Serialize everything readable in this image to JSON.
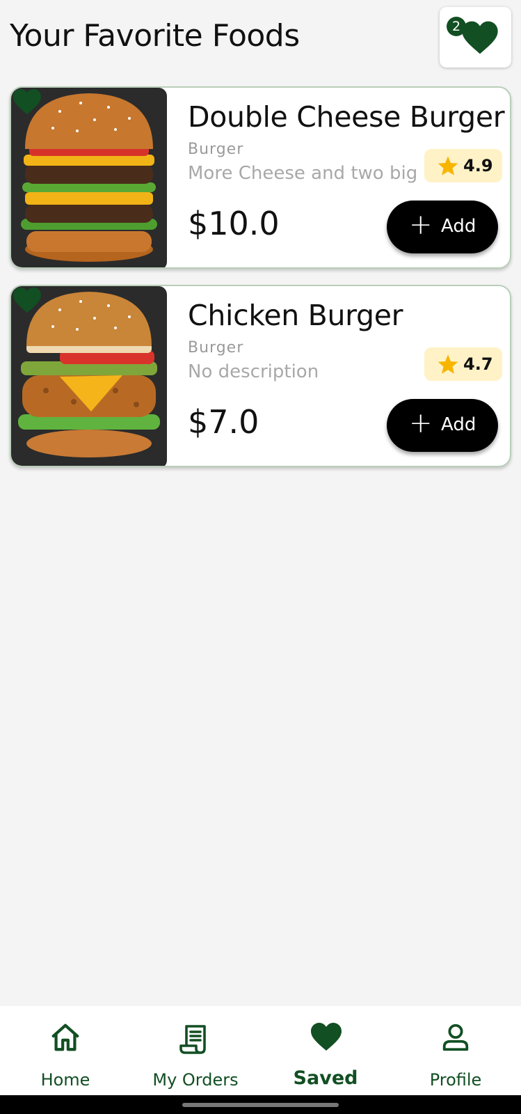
{
  "header": {
    "title": "Your Favorite Foods",
    "favorites_count": "2"
  },
  "foods": [
    {
      "name": "Double Cheese Burger",
      "category": "Burger",
      "description": "More Cheese and two big beef",
      "rating": "4.9",
      "price": "$10.0",
      "add_label": "Add"
    },
    {
      "name": "Chicken Burger",
      "category": "Burger",
      "description": "No description",
      "rating": "4.7",
      "price": "$7.0",
      "add_label": "Add"
    }
  ],
  "nav": {
    "items": [
      {
        "label": "Home",
        "icon": "home-icon"
      },
      {
        "label": "My Orders",
        "icon": "receipt-icon"
      },
      {
        "label": "Saved",
        "icon": "heart-icon",
        "active": true
      },
      {
        "label": "Profile",
        "icon": "person-icon"
      }
    ]
  },
  "colors": {
    "accent": "#124f23",
    "rating_bg": "#fff2c6",
    "star": "#f7b500"
  }
}
